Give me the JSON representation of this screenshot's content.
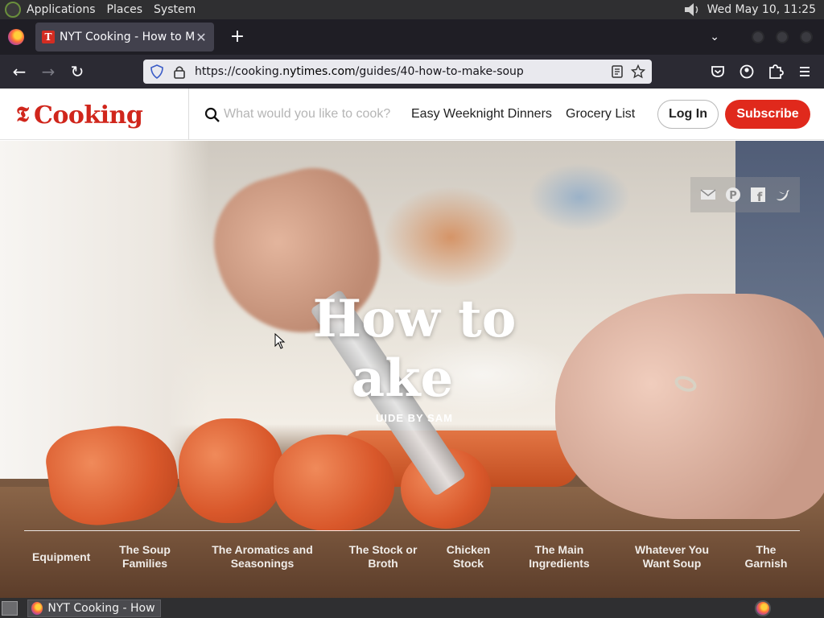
{
  "top_panel": {
    "menus": [
      "Applications",
      "Places",
      "System"
    ],
    "clock": "Wed May 10, 11:25"
  },
  "browser": {
    "tab_title": "NYT Cooking - How to Make Soup",
    "url_prefix": "https://cooking.",
    "url_domain": "nytimes.com",
    "url_path": "/guides/40-how-to-make-soup"
  },
  "site": {
    "logo_text": "Cooking",
    "search_placeholder": "What would you like to cook?",
    "nav_links": [
      "Easy Weeknight Dinners",
      "Grocery List"
    ],
    "login_label": "Log In",
    "subscribe_label": "Subscribe",
    "brand_color": "#d0261c"
  },
  "hero": {
    "title_line1": "How to",
    "title_line2": "ake",
    "byline": "UIDE BY SAM",
    "share_icons": [
      "email-icon",
      "pinterest-icon",
      "facebook-icon",
      "twitter-icon"
    ],
    "chapters": [
      "Equipment",
      "The Soup Families",
      "The Aromatics and Seasonings",
      "The Stock or Broth",
      "Chicken Stock",
      "The Main Ingredients",
      "Whatever You Want Soup",
      "The Garnish"
    ]
  },
  "taskbar": {
    "window_label": "NYT Cooking - How ..."
  }
}
